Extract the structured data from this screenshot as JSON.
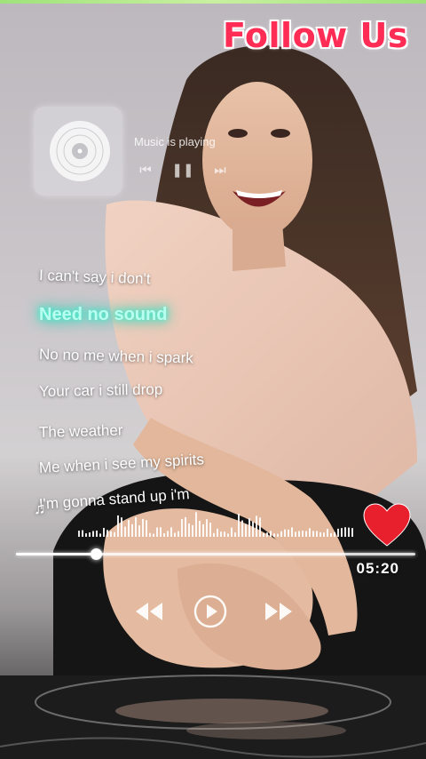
{
  "header": {
    "follow_text": "Follow Us"
  },
  "now_playing": {
    "status_text": "Music is playing",
    "cover_icon": "vinyl-record-icon",
    "controls": [
      "previous-icon",
      "pause-icon",
      "next-icon"
    ]
  },
  "lyrics": {
    "lines": [
      "I can't say i don't",
      "Need no sound",
      "No no me when i spark",
      "Your car i still drop",
      "The weather",
      "Me when i see my spirits",
      "I'm gonna stand up i'm"
    ],
    "active_index": 1,
    "accent_color": "#3ff2d0"
  },
  "player": {
    "progress": 0.2,
    "time_display": "05:20",
    "heart_color": "#e8202e",
    "buttons": [
      "rewind-icon",
      "play-icon",
      "fast-forward-icon"
    ]
  },
  "colors": {
    "follow": "#ff2d55",
    "top_line": "#9fe27a"
  }
}
